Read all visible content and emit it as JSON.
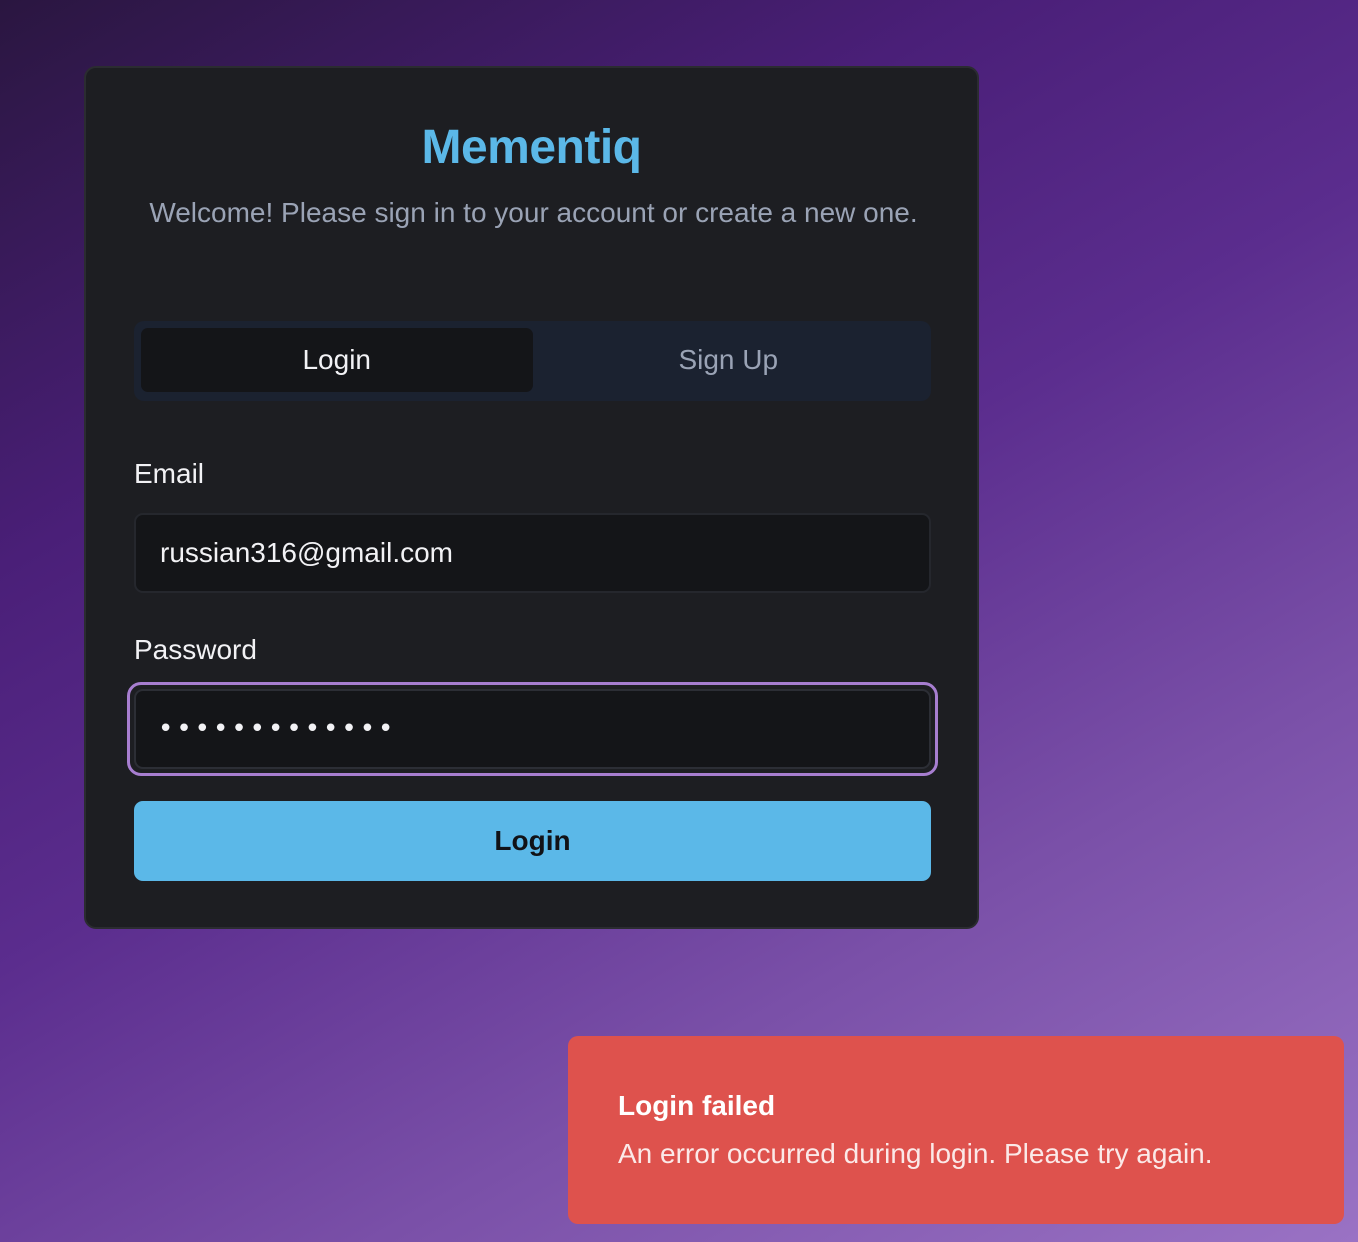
{
  "app": {
    "title": "Mementiq",
    "subtitle": "Welcome! Please sign in to your account or create a new one."
  },
  "tabs": [
    {
      "label": "Login",
      "active": true
    },
    {
      "label": "Sign Up",
      "active": false
    }
  ],
  "form": {
    "email_label": "Email",
    "email_value": "russian316@gmail.com",
    "password_label": "Password",
    "password_value": "•••••••••••••",
    "submit_label": "Login"
  },
  "toast": {
    "title": "Login failed",
    "message": "An error occurred during login. Please try again.",
    "color": "#de524d"
  },
  "colors": {
    "accent": "#5bb8e8",
    "focus_ring": "#a77ed0",
    "card_bg": "#1d1e22"
  }
}
